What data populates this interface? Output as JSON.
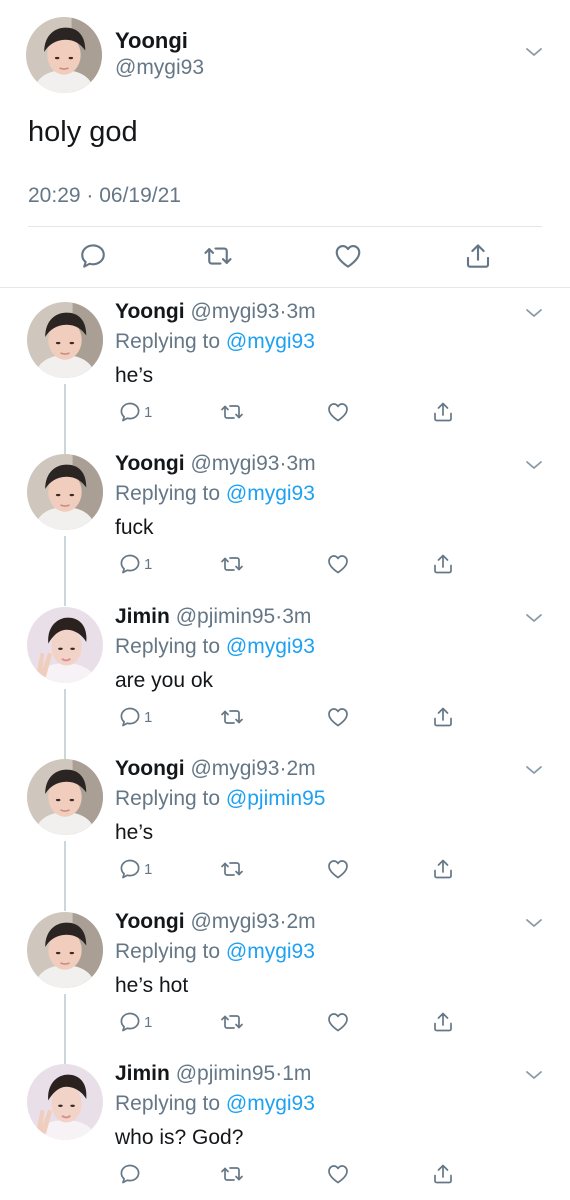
{
  "main_tweet": {
    "author_name": "Yoongi",
    "author_handle": "@mygi93",
    "text": "holy god",
    "timestamp": "20:29 · 06/19/21",
    "avatar": "yoongi-avatar"
  },
  "replies": [
    {
      "name": "Yoongi",
      "handle": "@mygi93",
      "time": "3m",
      "replying_prefix": "Replying to",
      "replying_to": "@mygi93",
      "text": "he’s",
      "reply_count": "1",
      "avatar": "yoongi-avatar"
    },
    {
      "name": "Yoongi",
      "handle": "@mygi93",
      "time": "3m",
      "replying_prefix": "Replying to",
      "replying_to": "@mygi93",
      "text": "fuck",
      "reply_count": "1",
      "avatar": "yoongi-avatar"
    },
    {
      "name": "Jimin",
      "handle": "@pjimin95",
      "time": "3m",
      "replying_prefix": "Replying to",
      "replying_to": "@mygi93",
      "text": "are you ok",
      "reply_count": "1",
      "avatar": "jimin-avatar"
    },
    {
      "name": "Yoongi",
      "handle": "@mygi93",
      "time": "2m",
      "replying_prefix": "Replying to",
      "replying_to": "@pjimin95",
      "text": "he’s",
      "reply_count": "1",
      "avatar": "yoongi-avatar"
    },
    {
      "name": "Yoongi",
      "handle": "@mygi93",
      "time": "2m",
      "replying_prefix": "Replying to",
      "replying_to": "@mygi93",
      "text": "he’s hot",
      "reply_count": "1",
      "avatar": "yoongi-avatar"
    },
    {
      "name": "Jimin",
      "handle": "@pjimin95",
      "time": "1m",
      "replying_prefix": "Replying to",
      "replying_to": "@mygi93",
      "text": "who is? God?",
      "reply_count": "",
      "avatar": "jimin-avatar"
    }
  ],
  "icons": {
    "reply": "reply-icon",
    "retweet": "retweet-icon",
    "like": "heart-icon",
    "share": "share-icon",
    "menu": "chevron-down-icon"
  },
  "colors": {
    "link": "#1da1f2",
    "secondary_text": "#657786",
    "divider": "#e1e8ed",
    "thread_line": "#ccd6dd"
  }
}
